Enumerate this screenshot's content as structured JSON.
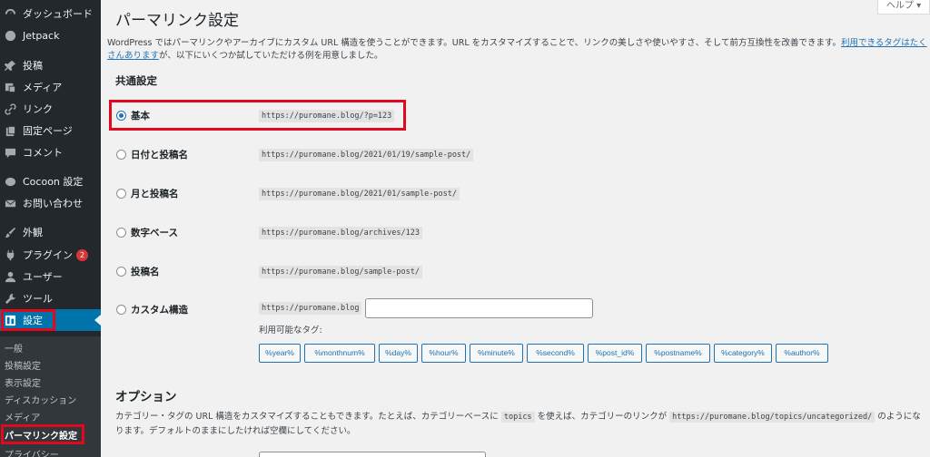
{
  "sidebar": {
    "items": [
      {
        "label": "ダッシュボード",
        "icon": "dashboard-icon"
      },
      {
        "label": "Jetpack",
        "icon": "jetpack-icon"
      },
      {
        "label": "投稿",
        "icon": "pushpin-icon"
      },
      {
        "label": "メディア",
        "icon": "media-icon"
      },
      {
        "label": "リンク",
        "icon": "link-icon"
      },
      {
        "label": "固定ページ",
        "icon": "page-icon"
      },
      {
        "label": "コメント",
        "icon": "comment-icon"
      },
      {
        "label": "Cocoon 設定",
        "icon": "cocoon-icon"
      },
      {
        "label": "お問い合わせ",
        "icon": "mail-icon"
      },
      {
        "label": "外観",
        "icon": "brush-icon"
      },
      {
        "label": "プラグイン",
        "icon": "plugin-icon",
        "badge": "2"
      },
      {
        "label": "ユーザー",
        "icon": "user-icon"
      },
      {
        "label": "ツール",
        "icon": "wrench-icon"
      },
      {
        "label": "設定",
        "icon": "settings-icon"
      }
    ],
    "submenu": [
      "一般",
      "投稿設定",
      "表示設定",
      "ディスカッション",
      "メディア",
      "パーマリンク設定",
      "プライバシー"
    ]
  },
  "header": {
    "title": "パーマリンク設定",
    "help": "ヘルプ ▾"
  },
  "intro": {
    "text": "WordPress ではパーマリンクやアーカイブにカスタム URL 構造を使うことができます。URL をカスタマイズすることで、リンクの美しさや使いやすさ、そして前方互換性を改善できます。",
    "link": "利用できるタグはたくさんあります",
    "text2": "が、以下にいくつか試していただける例を用意しました。"
  },
  "common": {
    "heading": "共通設定",
    "options": [
      {
        "label": "基本",
        "example": "https://puromane.blog/?p=123",
        "selected": true
      },
      {
        "label": "日付と投稿名",
        "example": "https://puromane.blog/2021/01/19/sample-post/",
        "selected": false
      },
      {
        "label": "月と投稿名",
        "example": "https://puromane.blog/2021/01/sample-post/",
        "selected": false
      },
      {
        "label": "数字ベース",
        "example": "https://puromane.blog/archives/123",
        "selected": false
      },
      {
        "label": "投稿名",
        "example": "https://puromane.blog/sample-post/",
        "selected": false
      },
      {
        "label": "カスタム構造",
        "example": "https://puromane.blog",
        "selected": false
      }
    ],
    "custom_value": "",
    "available_tags_label": "利用可能なタグ:",
    "tags": [
      "%year%",
      "%monthnum%",
      "%day%",
      "%hour%",
      "%minute%",
      "%second%",
      "%post_id%",
      "%postname%",
      "%category%",
      "%author%"
    ]
  },
  "options_section": {
    "heading": "オプション",
    "desc_a": "カテゴリー・タグの URL 構造をカスタマイズすることもできます。たとえば、カテゴリーベースに",
    "code1": "topics",
    "desc_b": "を使えば、カテゴリーのリンクが",
    "code2": "https://puromane.blog/topics/uncategorized/",
    "desc_c": "のようになります。デフォルトのままにしたければ空欄にしてください。"
  },
  "colors": {
    "sidebar_bg": "#23282d",
    "accent": "#0073aa",
    "link": "#2271b1",
    "highlight": "#e2091e"
  }
}
